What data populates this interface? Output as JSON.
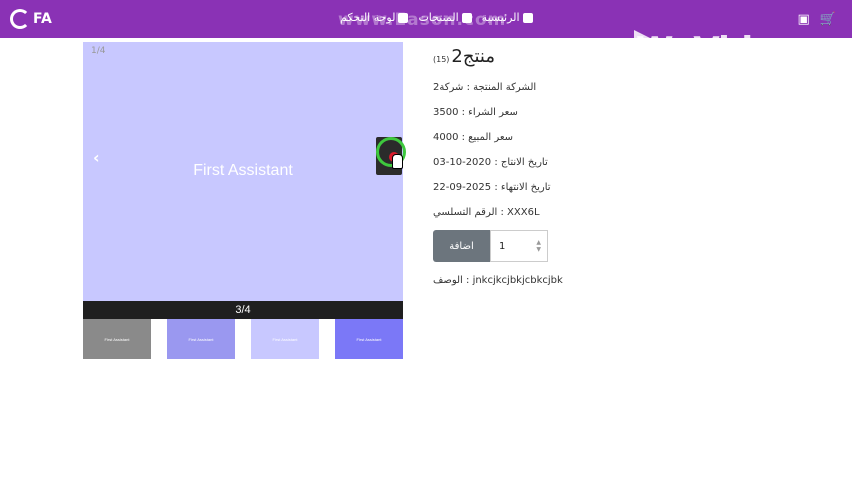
{
  "nav": {
    "brand": "FA",
    "links": [
      {
        "label": "الرئيسية",
        "icon": "home-icon"
      },
      {
        "label": "المنتجات",
        "icon": "shop-icon"
      },
      {
        "label": "لوحة التحكم",
        "icon": "dashboard-icon"
      }
    ],
    "right_icons": [
      "cart-icon",
      "image-icon"
    ],
    "overlay_watermark": "www.Eason.com",
    "video_watermark": "WeVideo"
  },
  "carousel": {
    "corner_counter": "1/4",
    "slide_text": "First Assistant",
    "caption": "3/4",
    "thumbnails": [
      {
        "text": "First Assistant",
        "color": "#8a8a8a"
      },
      {
        "text": "First Assistant",
        "color": "#9a98f0"
      },
      {
        "text": "First Assistant",
        "color": "#c8c8ff"
      },
      {
        "text": "First Assistant",
        "color": "#7b78f7"
      }
    ]
  },
  "product": {
    "title": "منتج2",
    "count": "(15)",
    "company": "الشركة المنتجة : شركة2",
    "purchase_price": "سعر الشراء : 3500",
    "sale_price": "سعر المبيع : 4000",
    "production_date": "تاريخ الانتاج : 2020-10-03",
    "expiry_date": "تاريخ الانتهاء : 2025-09-22",
    "serial": "الرقم التسلسي : XXX6L",
    "description": "الوصف : jnkcjkcjbkjcbkcjbk"
  },
  "cart": {
    "add_label": "اضافة",
    "quantity": "1"
  },
  "colors": {
    "navbar": "#8a32b5",
    "slide_bg": "#c8c8ff",
    "add_button": "#6c757d"
  }
}
